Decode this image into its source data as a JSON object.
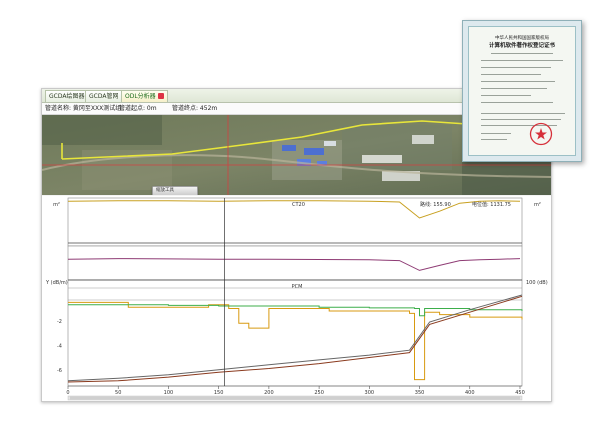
{
  "tabs": [
    {
      "label": "GCDA绘图器",
      "active": false
    },
    {
      "label": "GCDA管网",
      "active": false
    },
    {
      "label": "ODL分析器",
      "active": true
    }
  ],
  "info": {
    "pipe_name": "管道名称: 黄冈至XXX测试组",
    "start": "管道起点: 0m",
    "end": "管道终点: 452m"
  },
  "zoom_panel": {
    "title": "缩放工具",
    "buttons": [
      "+",
      "-",
      "□"
    ]
  },
  "plot1": {
    "left_unit": "m²",
    "right_unit": "m²",
    "readout_left": "CT20",
    "readout_mid": "路线: 155.90",
    "readout_right": "电位值: 1131.75"
  },
  "plot3": {
    "left_axis": "Y (dB/m)",
    "right_axis": "100 (dB)",
    "panel_label": "PCM",
    "y_ticks": [
      "-2",
      "-4",
      "-6"
    ],
    "x_ticks": [
      "0",
      "50",
      "100",
      "150",
      "200",
      "250",
      "300",
      "350",
      "400",
      "450"
    ]
  },
  "certificate": {
    "header": "中华人民共和国国家版权局",
    "title": "计算机软件著作权登记证书"
  },
  "colors": {
    "yellow": "#c8a020",
    "purple": "#8e3b74",
    "orange": "#d89a10",
    "green": "#3cae4a",
    "brown": "#8a3a1e",
    "gray": "#666666"
  },
  "chart_data": [
    {
      "type": "line",
      "title": "",
      "series": [
        {
          "x": [
            0,
            50,
            100,
            150,
            200,
            250,
            300,
            330,
            350,
            370,
            390,
            410,
            430,
            450
          ],
          "values": [
            0.97,
            0.98,
            0.98,
            0.97,
            0.98,
            0.98,
            0.97,
            0.95,
            0.55,
            0.72,
            0.92,
            0.97,
            0.98,
            0.97
          ]
        }
      ],
      "xlim": [
        0,
        452
      ]
    },
    {
      "type": "line",
      "title": "",
      "series": [
        {
          "x": [
            0,
            50,
            100,
            150,
            200,
            250,
            300,
            330,
            350,
            370,
            390,
            410,
            430,
            450
          ],
          "values": [
            0.6,
            0.62,
            0.61,
            0.6,
            0.6,
            0.59,
            0.58,
            0.55,
            0.2,
            0.38,
            0.55,
            0.58,
            0.6,
            0.62
          ]
        }
      ],
      "xlim": [
        0,
        452
      ]
    },
    {
      "type": "line",
      "title": "",
      "xlabel": "",
      "ylabel": "Y (dB/m)",
      "xlim": [
        0,
        452
      ],
      "ylim": [
        -7,
        1
      ],
      "series": [
        {
          "x": [
            0,
            30,
            60,
            100,
            140,
            160,
            170,
            180,
            200,
            230,
            260,
            300,
            340,
            345,
            350,
            355,
            370,
            400,
            452
          ],
          "values": [
            -0.5,
            -0.5,
            -0.9,
            -0.9,
            -0.7,
            -1.0,
            -2.2,
            -2.6,
            -1.0,
            -1.0,
            -1.2,
            -1.2,
            -1.4,
            -6.8,
            -6.8,
            -1.3,
            -1.5,
            -1.7,
            -1.9
          ]
        },
        {
          "x": [
            0,
            50,
            100,
            150,
            200,
            250,
            300,
            345,
            350,
            355,
            400,
            452
          ],
          "values": [
            -0.7,
            -0.7,
            -0.75,
            -0.8,
            -0.8,
            -0.9,
            -0.95,
            -1.0,
            -1.6,
            -1.0,
            -1.1,
            -1.2
          ]
        },
        {
          "x": [
            0,
            50,
            100,
            150,
            200,
            250,
            300,
            340,
            360,
            400,
            452
          ],
          "values": [
            -7.0,
            -6.9,
            -6.6,
            -6.2,
            -5.9,
            -5.5,
            -5.0,
            -4.6,
            -2.3,
            -1.3,
            0.0
          ]
        },
        {
          "x": [
            0,
            50,
            100,
            150,
            200,
            250,
            300,
            340,
            360,
            400,
            452
          ],
          "values": [
            -6.9,
            -6.7,
            -6.4,
            -6.0,
            -5.6,
            -5.2,
            -4.8,
            -4.4,
            -2.1,
            -1.1,
            0.1
          ]
        }
      ]
    }
  ]
}
